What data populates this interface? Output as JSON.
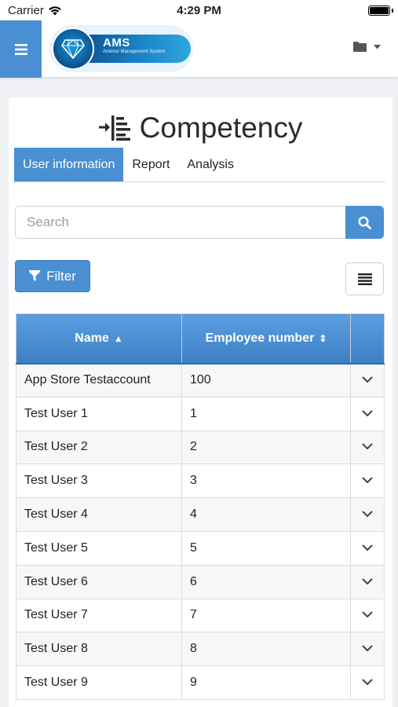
{
  "status_bar": {
    "carrier": "Carrier",
    "time": "4:29 PM"
  },
  "header": {
    "logo_title": "AMS",
    "logo_subtitle": "Antenor Management System"
  },
  "page": {
    "title": "Competency"
  },
  "tabs": [
    {
      "label": "User information",
      "active": true
    },
    {
      "label": "Report",
      "active": false
    },
    {
      "label": "Analysis",
      "active": false
    }
  ],
  "search": {
    "placeholder": "Search",
    "value": ""
  },
  "filter": {
    "label": "Filter"
  },
  "table": {
    "columns": [
      {
        "label": "Name",
        "sort": "▲"
      },
      {
        "label": "Employee number",
        "sort": "⇕"
      }
    ],
    "rows": [
      {
        "name": "App Store Testaccount",
        "number": "100"
      },
      {
        "name": "Test User 1",
        "number": "1"
      },
      {
        "name": "Test User 2",
        "number": "2"
      },
      {
        "name": "Test User 3",
        "number": "3"
      },
      {
        "name": "Test User 4",
        "number": "4"
      },
      {
        "name": "Test User 5",
        "number": "5"
      },
      {
        "name": "Test User 6",
        "number": "6"
      },
      {
        "name": "Test User 7",
        "number": "7"
      },
      {
        "name": "Test User 8",
        "number": "8"
      },
      {
        "name": "Test User 9",
        "number": "9"
      }
    ]
  },
  "colors": {
    "accent": "#4a8fd2",
    "header_gradient_top": "#5a9ee0",
    "header_gradient_bottom": "#3e7fc4"
  },
  "icons": {
    "menu": "hamburger-icon",
    "folder": "folder-icon",
    "search": "search-icon",
    "filter": "funnel-icon",
    "list": "list-icon",
    "expand": "chevron-down-icon",
    "title": "indent-list-icon"
  }
}
